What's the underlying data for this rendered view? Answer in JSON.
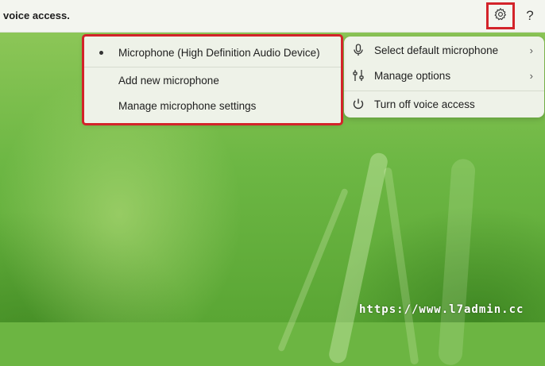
{
  "topbar": {
    "text": "voice access.",
    "help_label": "?"
  },
  "icons": {
    "settings": "gear-icon",
    "help": "question-icon",
    "microphone": "microphone-icon",
    "manage": "sliders-icon",
    "power": "power-icon",
    "chevron": "chevron-right-icon"
  },
  "main_menu": {
    "items": [
      {
        "label": "Select default microphone",
        "chevron": "›"
      },
      {
        "label": "Manage options",
        "chevron": "›"
      },
      {
        "label": "Turn off voice access"
      }
    ]
  },
  "mic_menu": {
    "items": [
      {
        "label": "Microphone (High Definition Audio Device)",
        "selected": true
      },
      {
        "label": "Add new microphone"
      },
      {
        "label": "Manage microphone settings"
      }
    ]
  },
  "highlight_color": "#d3232a",
  "watermark": "https://www.l7admin.cc"
}
